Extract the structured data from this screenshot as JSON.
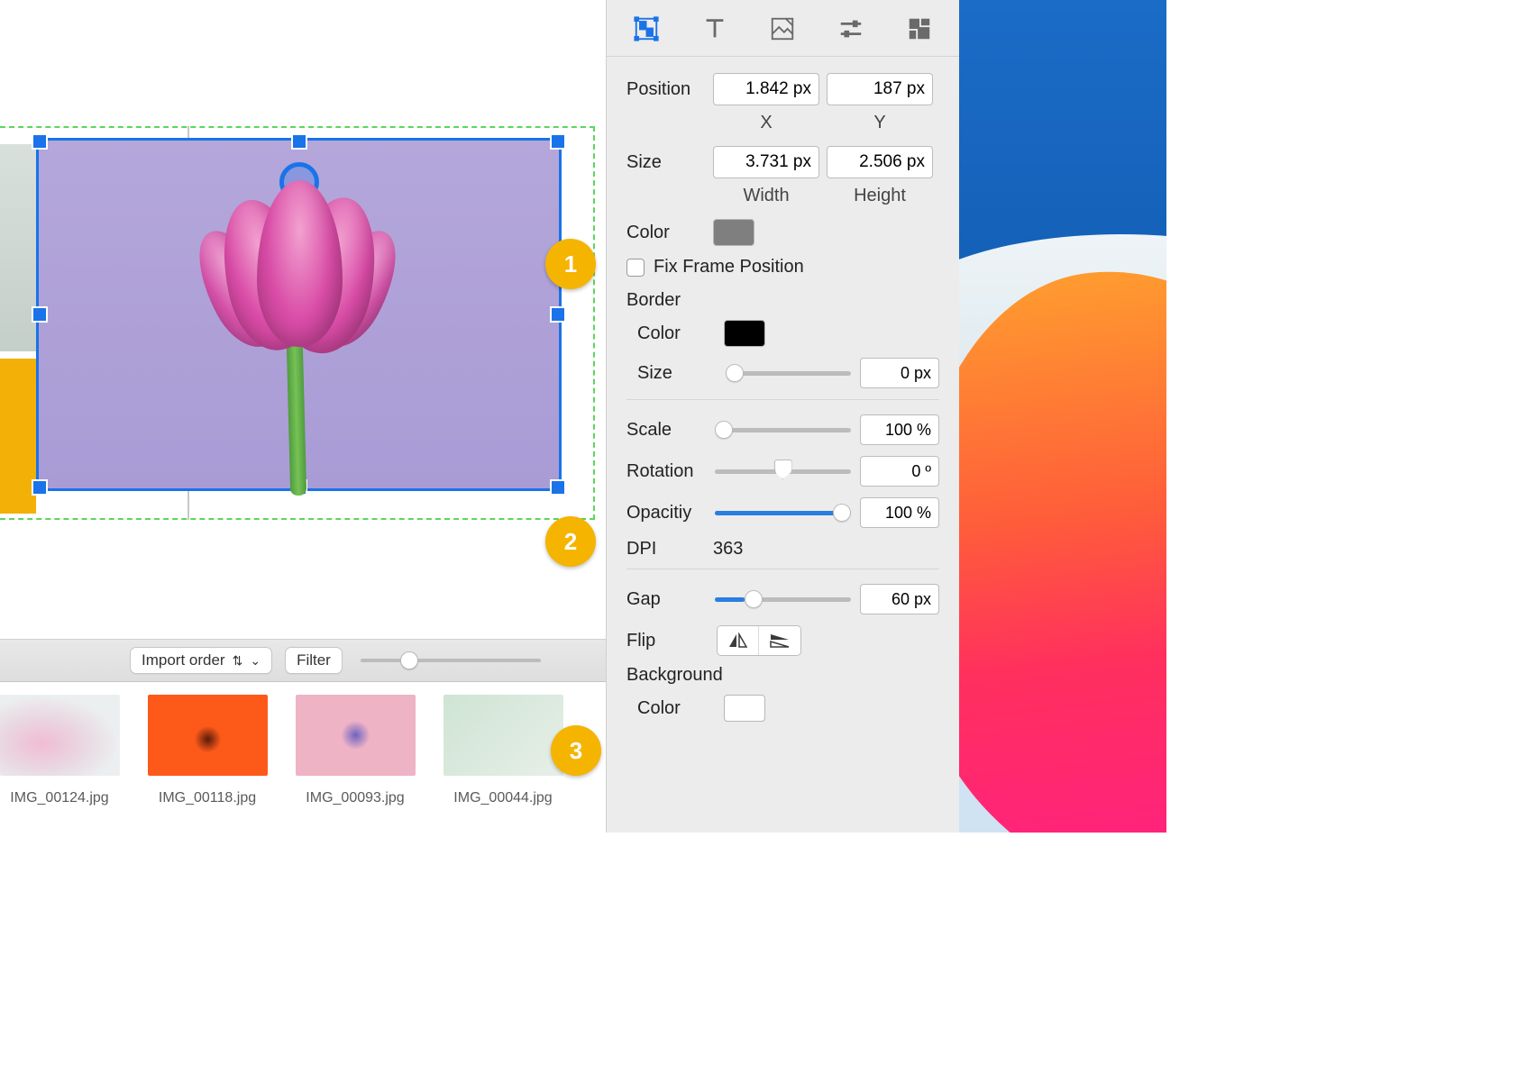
{
  "callouts": {
    "one": "1",
    "two": "2",
    "three": "3"
  },
  "filmstrip": {
    "sort_label": "Import order",
    "filter_label": "Filter",
    "items": [
      {
        "name": "IMG_00124.jpg"
      },
      {
        "name": "IMG_00118.jpg"
      },
      {
        "name": "IMG_00093.jpg"
      },
      {
        "name": "IMG_00044.jpg"
      }
    ]
  },
  "inspector": {
    "tabs": [
      "geometry",
      "text",
      "image",
      "adjustments",
      "arrange"
    ],
    "position_label": "Position",
    "position_x": "1.842 px",
    "position_y": "187 px",
    "x_label": "X",
    "y_label": "Y",
    "size_label": "Size",
    "width": "3.731 px",
    "height": "2.506 px",
    "width_label": "Width",
    "height_label": "Height",
    "color_label": "Color",
    "color_swatch": "#7f7f7f",
    "fix_frame_label": "Fix Frame Position",
    "border_label": "Border",
    "border_color_label": "Color",
    "border_color_swatch": "#000000",
    "border_size_label": "Size",
    "border_size": "0 px",
    "scale_label": "Scale",
    "scale_value": "100 %",
    "rotation_label": "Rotation",
    "rotation_value": "0 º",
    "opacity_label": "Opacitiy",
    "opacity_value": "100 %",
    "dpi_label": "DPI",
    "dpi_value": "363",
    "gap_label": "Gap",
    "gap_value": "60 px",
    "flip_label": "Flip",
    "background_label": "Background",
    "background_color_label": "Color",
    "background_color_swatch": "#ffffff"
  }
}
